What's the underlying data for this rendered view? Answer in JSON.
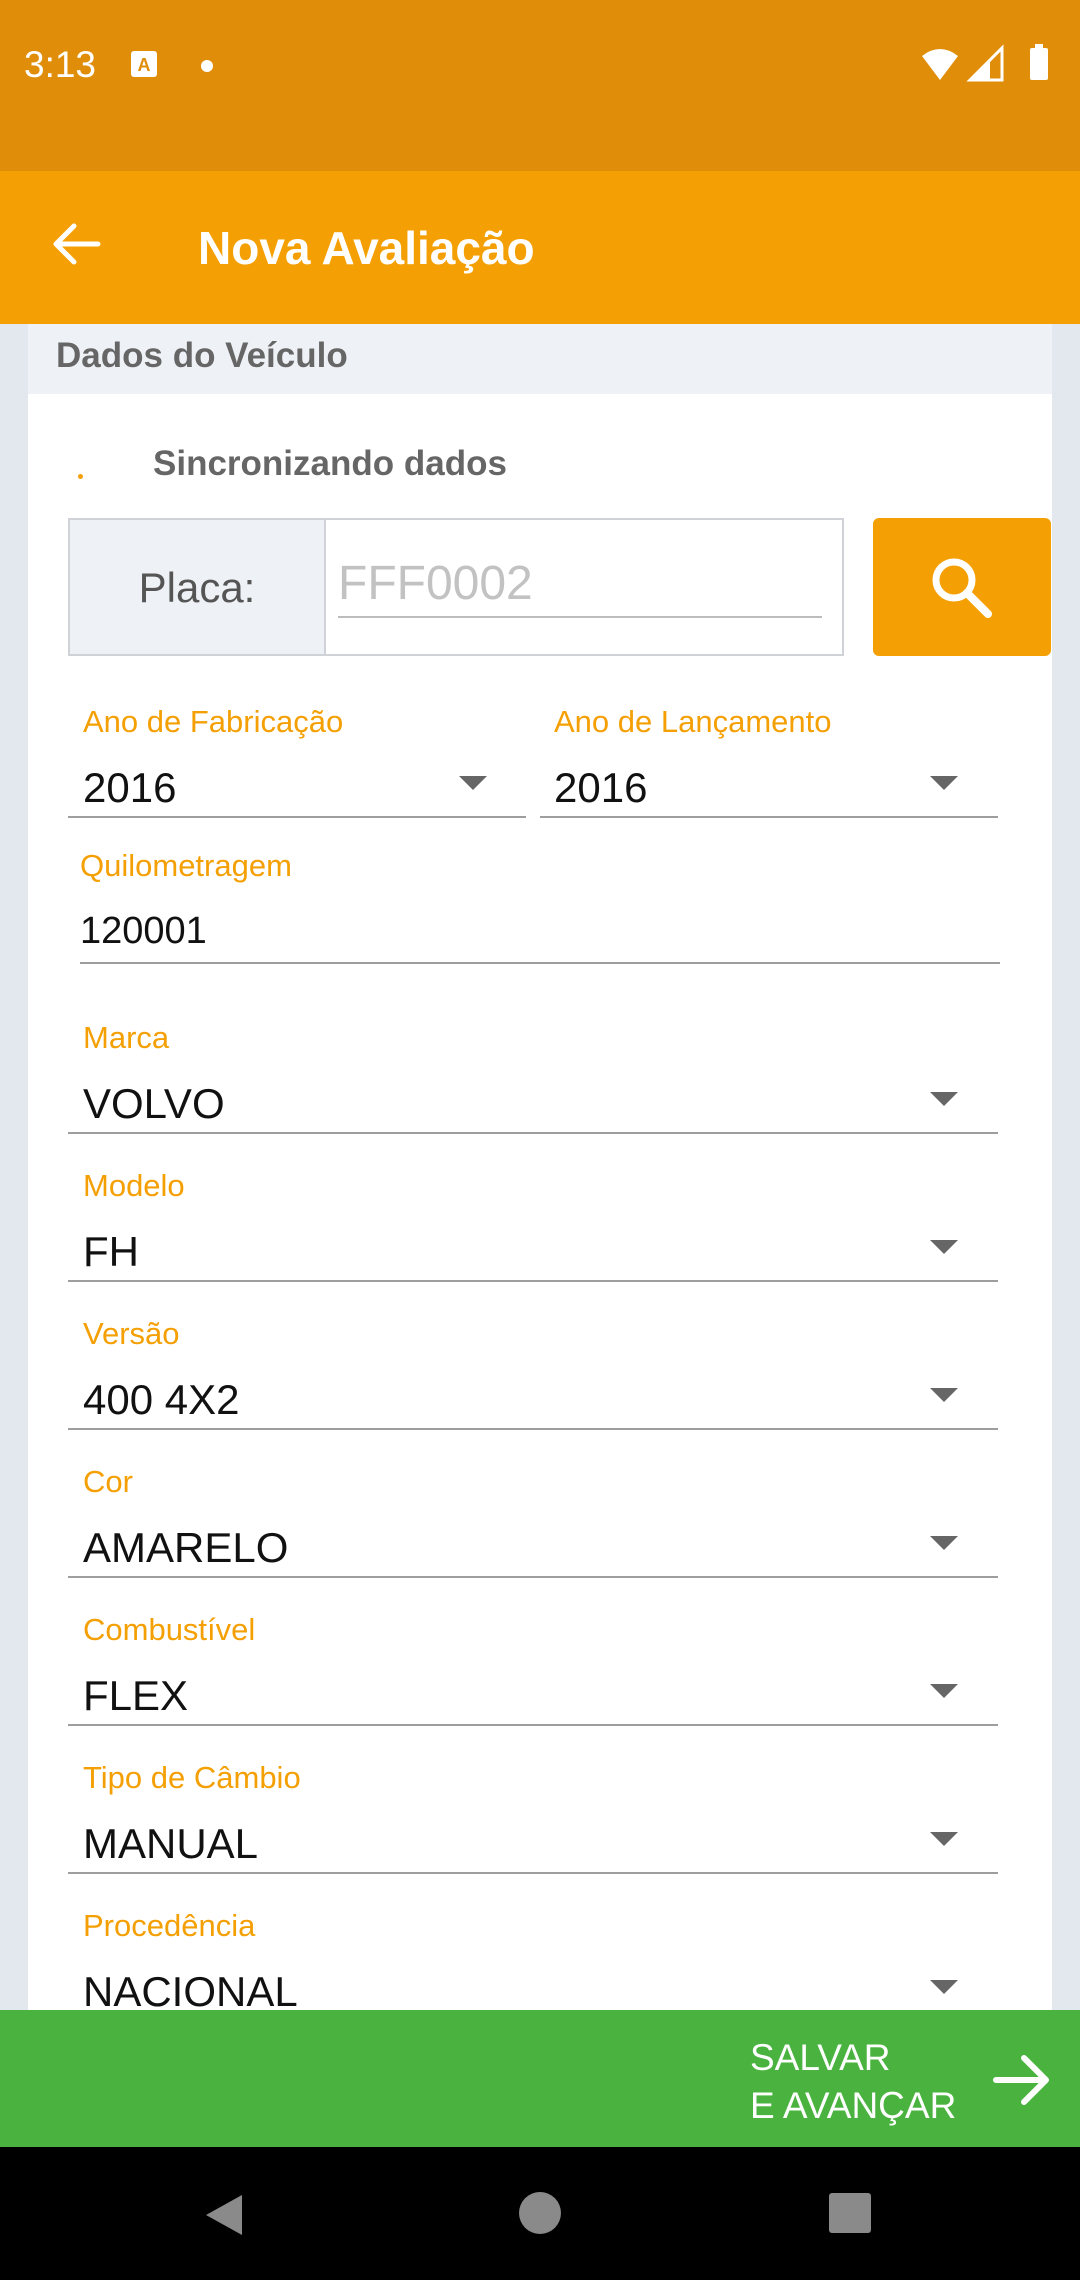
{
  "status_bar": {
    "time": "3:13",
    "icons": [
      "keyboard-a-icon",
      "notification-dot-icon",
      "wifi-icon",
      "signal-icon",
      "battery-icon"
    ]
  },
  "app_bar": {
    "title": "Nova Avaliação",
    "back_icon": "arrow-left-icon"
  },
  "section": {
    "title": "Dados do Veículo",
    "sync_text": "Sincronizando dados"
  },
  "plate": {
    "label": "Placa:",
    "placeholder": "FFF0002",
    "value": "",
    "search_icon": "search-icon"
  },
  "fields": {
    "ano_fabricacao": {
      "label": "Ano de Fabricação",
      "value": "2016"
    },
    "ano_lancamento": {
      "label": "Ano de Lançamento",
      "value": "2016"
    },
    "quilometragem": {
      "label": "Quilometragem",
      "value": "120001"
    },
    "marca": {
      "label": "Marca",
      "value": "VOLVO"
    },
    "modelo": {
      "label": "Modelo",
      "value": "FH"
    },
    "versao": {
      "label": "Versão",
      "value": "400 4X2"
    },
    "cor": {
      "label": "Cor",
      "value": "AMARELO"
    },
    "combustivel": {
      "label": "Combustível",
      "value": "FLEX"
    },
    "tipo_cambio": {
      "label": "Tipo de Câmbio",
      "value": "MANUAL"
    },
    "procedencia": {
      "label": "Procedência",
      "value": "NACIONAL"
    }
  },
  "save_button": {
    "label": "SALVAR\nE AVANÇAR",
    "icon": "arrow-right-icon"
  },
  "colors": {
    "status_bar": "#e08e0a",
    "app_bar": "#f4a004",
    "accent": "#f4a004",
    "save_bar": "#4ab33f"
  }
}
